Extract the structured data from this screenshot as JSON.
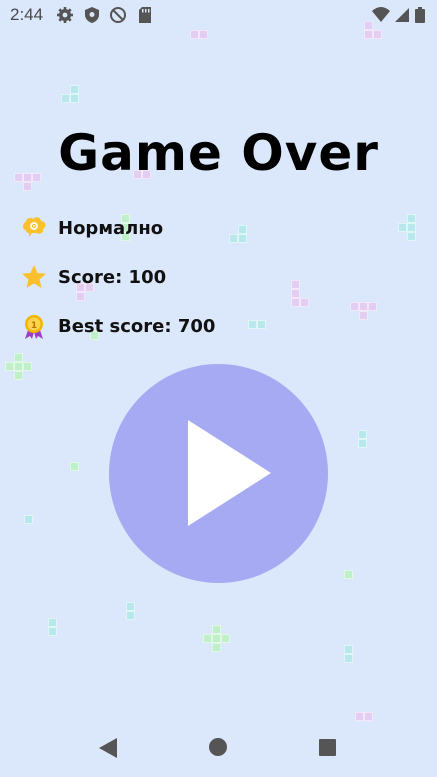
{
  "status_bar": {
    "time": "2:44",
    "left_icons": [
      "gear-icon",
      "shield-icon",
      "no-disturb-icon",
      "sd-card-icon"
    ],
    "right_icons": [
      "wifi-icon",
      "signal-icon",
      "battery-icon"
    ]
  },
  "game": {
    "title": "Game Over",
    "difficulty": "Нормално",
    "score": "Score: 100",
    "best_score": "Best score: 700"
  },
  "play_button": {
    "icon": "play-icon"
  },
  "nav": {
    "icons": [
      "back-icon",
      "home-icon",
      "recents-icon"
    ]
  },
  "colors": {
    "background": "#dbe8fb",
    "play_button": "#a6aaf3",
    "tile_purple": "#e3cdf3",
    "tile_cyan": "#b9e8ec",
    "tile_green": "#bff0c9",
    "star": "#fbc02d",
    "medal": "#f4b400",
    "ribbon": "#9c3ec8"
  }
}
